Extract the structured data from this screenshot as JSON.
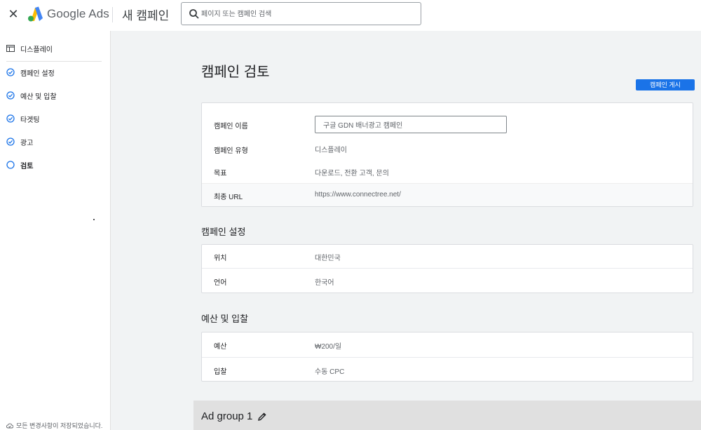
{
  "header": {
    "brand": "Google Ads",
    "page_heading": "새 캠페인",
    "search_placeholder": "페이지 또는 캠페인 검색",
    "close_icon": "close-icon",
    "logo_colors": [
      "#fbbc04",
      "#4285f4",
      "#34a853"
    ]
  },
  "sidebar": {
    "items": [
      {
        "label": "디스플레이",
        "icon": "display-icon",
        "state": "type"
      },
      {
        "label": "캠페인 설정",
        "icon": "check-circle-icon",
        "state": "done"
      },
      {
        "label": "예산 및 입찰",
        "icon": "check-circle-icon",
        "state": "done"
      },
      {
        "label": "타겟팅",
        "icon": "check-circle-icon",
        "state": "done"
      },
      {
        "label": "광고",
        "icon": "check-circle-icon",
        "state": "done"
      },
      {
        "label": "검토",
        "icon": "empty-circle-icon",
        "state": "current"
      }
    ],
    "footer": "모든 변경사항이 저장되었습니다."
  },
  "main": {
    "title": "캠페인 검토",
    "publish_label": "캠페인 게시",
    "summary": {
      "name_label": "캠페인 이름",
      "name_value": "구글 GDN 배너광고 캠페인",
      "type_label": "캠페인 유형",
      "type_value": "디스플레이",
      "goal_label": "목표",
      "goal_value": "다운로드, 전환 고객, 문의",
      "url_label": "최종 URL",
      "url_value": "https://www.connectree.net/"
    },
    "settings": {
      "title": "캠페인 설정",
      "location_label": "위치",
      "location_value": "대한민국",
      "language_label": "언어",
      "language_value": "한국어"
    },
    "budget": {
      "title": "예산 및 입찰",
      "budget_label": "예산",
      "budget_value": "₩200/일",
      "bidding_label": "입찰",
      "bidding_value": "수동 CPC"
    },
    "adgroup": {
      "title": "Ad group 1"
    }
  },
  "colors": {
    "accent": "#1a73e8",
    "check": "#1a73e8",
    "background": "#f1f3f4"
  }
}
